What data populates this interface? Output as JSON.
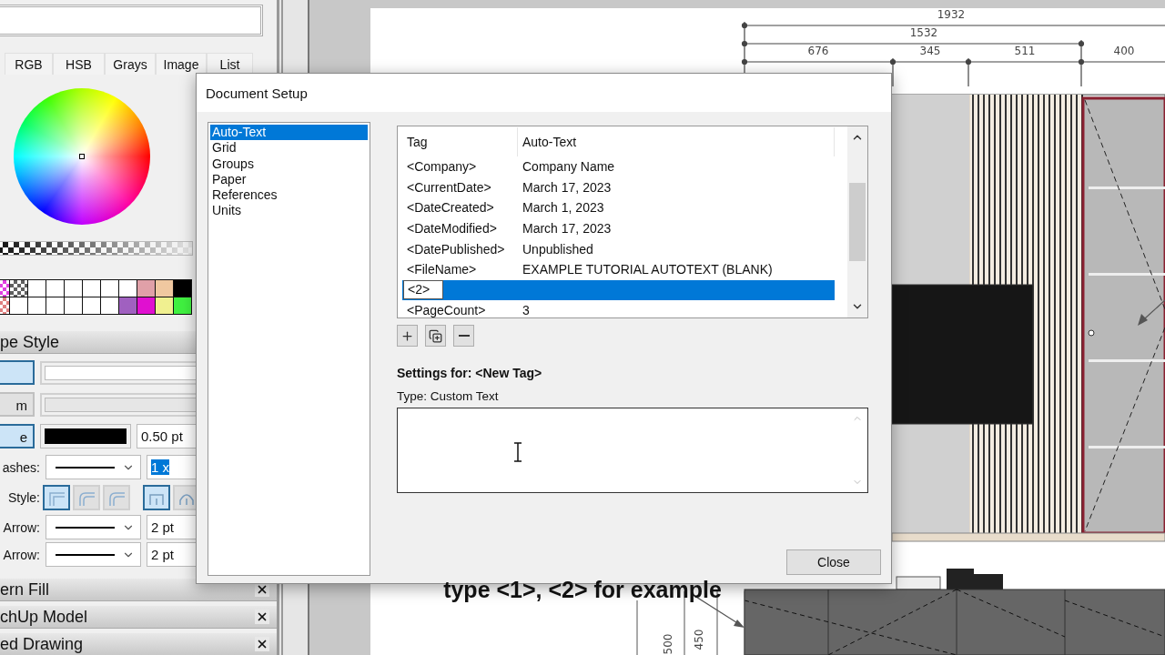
{
  "left_panel": {
    "color_tabs": [
      "RGB",
      "HSB",
      "Grays",
      "Image",
      "List"
    ],
    "swatch_rows": [
      [
        {
          "kind": "pattern",
          "color": "#e040e0"
        },
        {
          "kind": "pattern",
          "color": "#606060"
        },
        {
          "kind": "plain",
          "color": "#ffffff"
        },
        {
          "kind": "plain",
          "color": "#ffffff"
        },
        {
          "kind": "plain",
          "color": "#ffffff"
        },
        {
          "kind": "plain",
          "color": "#ffffff"
        },
        {
          "kind": "plain",
          "color": "#ffffff"
        },
        {
          "kind": "plain",
          "color": "#ffffff"
        },
        {
          "kind": "plain",
          "color": "#e0a0a8"
        },
        {
          "kind": "plain",
          "color": "#f0c8a0"
        },
        {
          "kind": "plain",
          "color": "#000000"
        }
      ],
      [
        {
          "kind": "pattern",
          "color": "#e08080"
        },
        {
          "kind": "plain",
          "color": "#ffffff"
        },
        {
          "kind": "plain",
          "color": "#ffffff"
        },
        {
          "kind": "plain",
          "color": "#ffffff"
        },
        {
          "kind": "plain",
          "color": "#ffffff"
        },
        {
          "kind": "plain",
          "color": "#ffffff"
        },
        {
          "kind": "plain",
          "color": "#ffffff"
        },
        {
          "kind": "plain",
          "color": "#a060c0"
        },
        {
          "kind": "plain",
          "color": "#e010d0"
        },
        {
          "kind": "plain",
          "color": "#f0f090"
        },
        {
          "kind": "plain",
          "color": "#40f040"
        }
      ]
    ],
    "style_title": "pe Style",
    "style_rows": [
      {
        "kind": "toggle",
        "on": true,
        "disabled": false
      },
      {
        "kind": "toggle",
        "label": "m",
        "on": false,
        "disabled": true
      },
      {
        "kind": "stroke",
        "label": "e",
        "on": true,
        "value": "0.50 pt"
      },
      {
        "kind": "dashes",
        "label": "ashes:",
        "value": "1 x"
      },
      {
        "kind": "corners",
        "label": "Style:",
        "joins": [
          {
            "selected": true
          },
          {
            "selected": false
          },
          {
            "selected": false
          }
        ],
        "caps": [
          {
            "selected": true
          },
          {
            "selected": false
          }
        ]
      },
      {
        "kind": "arrow",
        "label": "Arrow:",
        "value": "2 pt"
      },
      {
        "kind": "arrow",
        "label": "Arrow:",
        "value": "2 pt"
      }
    ],
    "collapsed_sections": [
      {
        "title": "ern Fill"
      },
      {
        "title": "chUp Model"
      },
      {
        "title": "ed Drawing"
      }
    ]
  },
  "canvas": {
    "horizontal_dimensions": [
      "1932",
      "1532",
      "676",
      "345",
      "511",
      "400"
    ],
    "vertical_dimensions": [
      "500",
      "450"
    ]
  },
  "dialog": {
    "title": "Document Setup",
    "categories": [
      {
        "label": "Auto-Text",
        "selected": true
      },
      {
        "label": "Grid",
        "selected": false
      },
      {
        "label": "Groups",
        "selected": false
      },
      {
        "label": "Paper",
        "selected": false
      },
      {
        "label": "References",
        "selected": false
      },
      {
        "label": "Units",
        "selected": false
      }
    ],
    "tag_table": {
      "columns": [
        "Tag",
        "Auto-Text"
      ],
      "rows": [
        {
          "tag": "<Company>",
          "value": "Company Name",
          "selected": false
        },
        {
          "tag": "<CurrentDate>",
          "value": "March 17, 2023",
          "selected": false
        },
        {
          "tag": "<DateCreated>",
          "value": "March 1, 2023",
          "selected": false
        },
        {
          "tag": "<DateModified>",
          "value": "March 17, 2023",
          "selected": false
        },
        {
          "tag": "<DatePublished>",
          "value": "Unpublished",
          "selected": false
        },
        {
          "tag": "<FileName>",
          "value": "EXAMPLE TUTORIAL AUTOTEXT (BLANK)",
          "selected": false
        },
        {
          "tag": "<2>",
          "selected": true
        },
        {
          "tag": "<PageCount>",
          "value": "3",
          "selected": false
        }
      ]
    },
    "settings_title": "Settings for: <New Tag>",
    "type_label": "Type: Custom Text",
    "close_button": "Close"
  },
  "caption": "type <1>, <2> for example"
}
